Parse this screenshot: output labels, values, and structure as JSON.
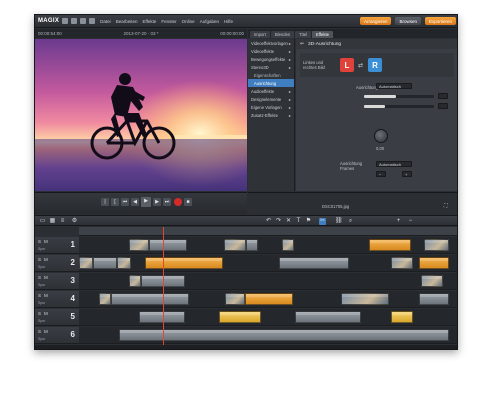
{
  "app": {
    "logo": "MAGIX",
    "menu": [
      "Datei",
      "Bearbeiten",
      "Effekte",
      "Fenster",
      "Online",
      "Aufgaben",
      "Hilfe"
    ],
    "buttons": {
      "arrange": "Arrangieren",
      "browse": "Browsen",
      "export": "Exportieren"
    }
  },
  "preview": {
    "timecode_left": "00:00:54:00",
    "date": "2013-07-20 · 03 *",
    "timecode_right": "00:00:00:00"
  },
  "panel": {
    "tabs": [
      "Import",
      "Blenden",
      "Titel",
      "Effekte"
    ],
    "active_tab": "Effekte",
    "effects": [
      {
        "label": "Videoeffektvorlagen",
        "arrow": "▸"
      },
      {
        "label": "Videoeffekte",
        "arrow": "▸"
      },
      {
        "label": "Bewegungseffekte",
        "arrow": "▸"
      },
      {
        "label": "Stereo3D",
        "arrow": "▸"
      },
      {
        "label": "Eigenschaften",
        "arrow": ""
      },
      {
        "label": "Ausrichtung",
        "arrow": ""
      },
      {
        "label": "Audioeffekte",
        "arrow": "▸"
      },
      {
        "label": "Designelemente",
        "arrow": "▸"
      },
      {
        "label": "Eigene Vorlagen",
        "arrow": "▸"
      },
      {
        "label": "Zusatz-Effekte",
        "arrow": "▸"
      }
    ],
    "selected_effect": "Ausrichtung",
    "title": "3D-Ausrichtung",
    "left_eye_label": "Linkes und rechtes Bild",
    "left_btn": "L",
    "right_btn": "R",
    "alignment_label": "Ausrichtung",
    "auto_label": "Automatisch",
    "value_label": "0,00",
    "bottom_label": "Ausrichtung Frames",
    "clip_name": "DSC01705.jpg"
  },
  "timeline": {
    "track_label": "Spur",
    "tracks": [
      {
        "num": "1",
        "clips": [
          {
            "type": "thumb",
            "l": 50,
            "w": 20
          },
          {
            "type": "gray",
            "l": 70,
            "w": 38
          },
          {
            "type": "thumb",
            "l": 145,
            "w": 22
          },
          {
            "type": "gray",
            "l": 167,
            "w": 12
          },
          {
            "type": "thumb",
            "l": 203,
            "w": 12
          },
          {
            "type": "orange",
            "l": 290,
            "w": 42
          },
          {
            "type": "thumb",
            "l": 345,
            "w": 25
          }
        ]
      },
      {
        "num": "2",
        "clips": [
          {
            "type": "thumb",
            "l": 0,
            "w": 14
          },
          {
            "type": "gray",
            "l": 14,
            "w": 24
          },
          {
            "type": "thumb",
            "l": 38,
            "w": 14
          },
          {
            "type": "orange",
            "l": 66,
            "w": 78
          },
          {
            "type": "gray",
            "l": 200,
            "w": 70
          },
          {
            "type": "thumb",
            "l": 312,
            "w": 22
          },
          {
            "type": "orange",
            "l": 340,
            "w": 30
          }
        ]
      },
      {
        "num": "3",
        "clips": [
          {
            "type": "thumb",
            "l": 50,
            "w": 12
          },
          {
            "type": "gray",
            "l": 62,
            "w": 44
          },
          {
            "type": "thumb",
            "l": 342,
            "w": 22
          }
        ]
      },
      {
        "num": "4",
        "clips": [
          {
            "type": "thumb",
            "l": 20,
            "w": 12
          },
          {
            "type": "gray",
            "l": 32,
            "w": 78
          },
          {
            "type": "thumb",
            "l": 146,
            "w": 20
          },
          {
            "type": "orange",
            "l": 166,
            "w": 48
          },
          {
            "type": "thumb",
            "l": 262,
            "w": 48
          },
          {
            "type": "gray",
            "l": 340,
            "w": 30
          }
        ]
      },
      {
        "num": "5",
        "clips": [
          {
            "type": "gray",
            "l": 60,
            "w": 46
          },
          {
            "type": "yellow",
            "l": 140,
            "w": 42
          },
          {
            "type": "gray",
            "l": 216,
            "w": 66
          },
          {
            "type": "yellow",
            "l": 312,
            "w": 22
          }
        ]
      },
      {
        "num": "6",
        "clips": [
          {
            "type": "gray",
            "l": 40,
            "w": 330
          }
        ]
      }
    ]
  },
  "colors": {
    "accent_orange": "#e8921f",
    "record_red": "#d42a2a",
    "left_eye": "#e0413a",
    "right_eye": "#3a8fd6"
  }
}
